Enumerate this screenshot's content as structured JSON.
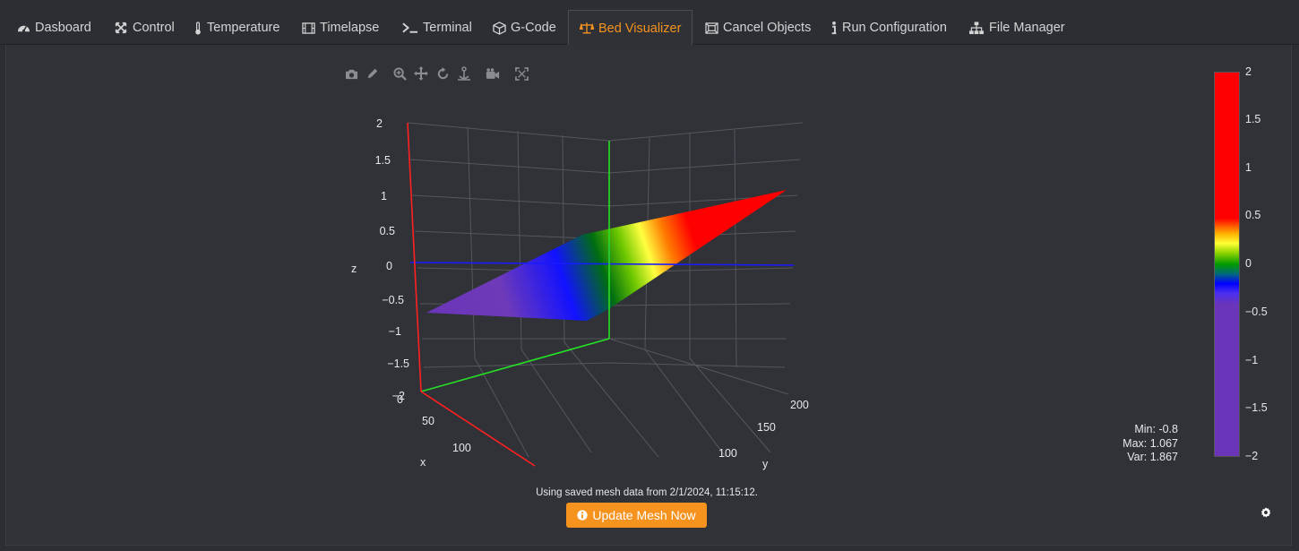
{
  "tabs": [
    {
      "label": "Dasboard",
      "icon": "dashboard-icon",
      "active": false
    },
    {
      "label": "Control",
      "icon": "arrows-icon",
      "active": false
    },
    {
      "label": "Temperature",
      "icon": "thermometer-icon",
      "active": false
    },
    {
      "label": "Timelapse",
      "icon": "film-icon",
      "active": false
    },
    {
      "label": "Terminal",
      "icon": "terminal-icon",
      "active": false
    },
    {
      "label": "G-Code",
      "icon": "cube-icon",
      "active": false
    },
    {
      "label": "Bed Visualizer",
      "icon": "balance-scale-icon",
      "active": true
    },
    {
      "label": "Cancel Objects",
      "icon": "object-icon",
      "active": false
    },
    {
      "label": "Run Configuration",
      "icon": "info-icon",
      "active": false
    },
    {
      "label": "File Manager",
      "icon": "sitemap-icon",
      "active": false
    }
  ],
  "modebar": [
    "camera-icon",
    "pencil-icon",
    "zoom-icon",
    "pan-icon",
    "orbit-icon",
    "turntable-icon",
    "reset-camera-icon",
    "autoscale-icon"
  ],
  "plot": {
    "z_axis_label": "z",
    "x_axis_label": "x",
    "y_axis_label_partial": "y",
    "z_ticks": [
      "2",
      "1.5",
      "1",
      "0.5",
      "0",
      "−0.5",
      "−1",
      "−1.5",
      "−2"
    ],
    "x_ticks": [
      "0",
      "50",
      "100"
    ],
    "y_ticks": [
      "200",
      "150",
      "100"
    ]
  },
  "colorbar": {
    "ticks": [
      "2",
      "1.5",
      "1",
      "0.5",
      "0",
      "−0.5",
      "−1",
      "−1.5",
      "−2"
    ],
    "range": [
      -2,
      2
    ],
    "colorscale": [
      "#6a35b8",
      "#0000ff",
      "#009a00",
      "#ffff33",
      "#ff0000"
    ]
  },
  "stats": {
    "min_label": "Min: -0.8",
    "max_label": "Max: 1.067",
    "var_label": "Var: 1.867"
  },
  "status_note": "Using saved mesh data from 2/1/2024, 11:15:12.",
  "update_button": {
    "label": "Update Mesh Now",
    "icon": "info-circle-icon"
  },
  "colors": {
    "accent": "#f6921e",
    "background": "#2c2e33",
    "panel": "#303238"
  }
}
